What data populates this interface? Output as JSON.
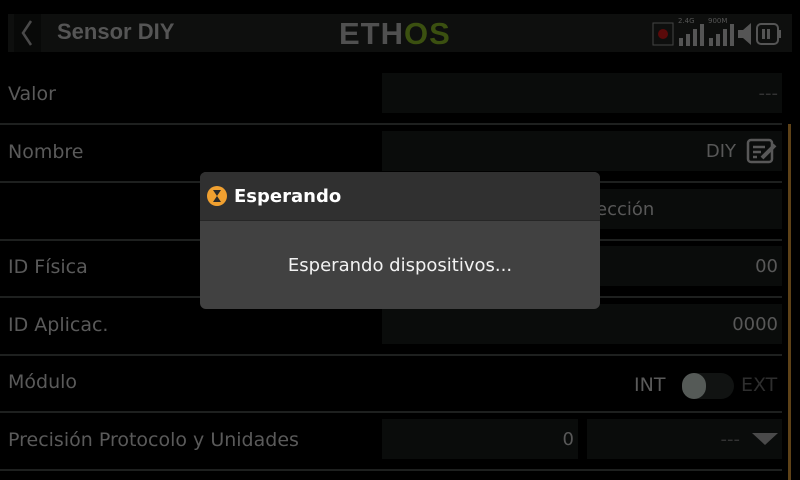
{
  "header": {
    "title": "Sensor DIY",
    "logo_left": "ETH",
    "logo_right": "OS",
    "rf_24": "2.4G",
    "rf_900": "900M",
    "accent": "#3b5010"
  },
  "rows": [
    {
      "label": "Valor",
      "value": "---"
    },
    {
      "label": "Nombre",
      "value": "DIY"
    },
    {
      "label": "",
      "value": "ección"
    },
    {
      "label": "ID Física",
      "value": "00"
    },
    {
      "label": "ID Aplicac.",
      "value": "0000"
    },
    {
      "label": "Módulo",
      "left": "INT",
      "right": "EXT"
    },
    {
      "label": "Precisión Protocolo y Unidades",
      "value": "0",
      "unit": "---"
    }
  ],
  "dialog": {
    "title": "Esperando",
    "message": "Esperando dispositivos...",
    "icon": "hourglass-icon",
    "icon_color": "#f0a030"
  }
}
